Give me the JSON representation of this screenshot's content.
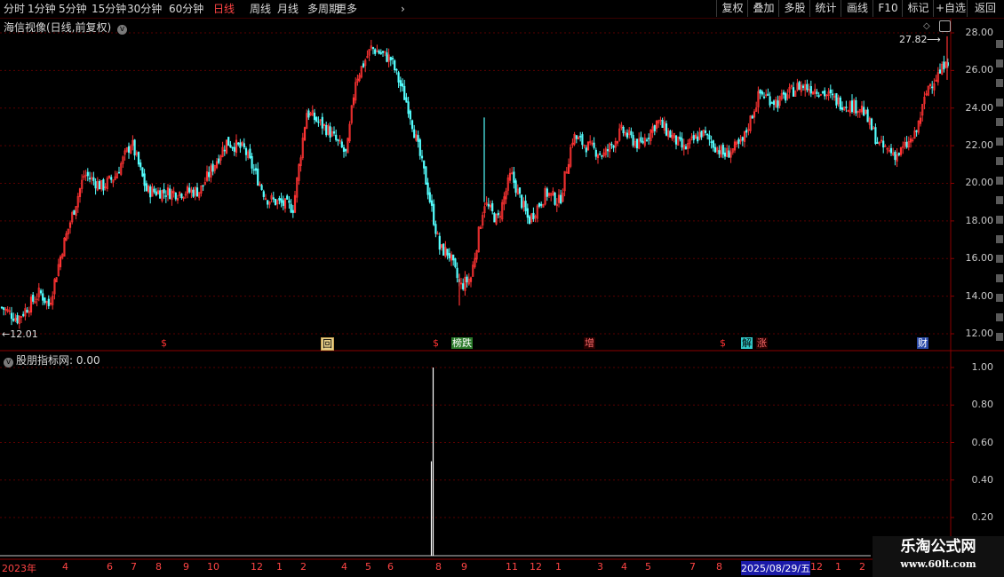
{
  "toolbar": {
    "periods": [
      "分时",
      "1分钟",
      "5分钟",
      "15分钟",
      "30分钟",
      "60分钟",
      "日线",
      "周线",
      "月线",
      "多周期",
      "更多"
    ],
    "active_period": "日线",
    "more_arrow": "›",
    "buttons": [
      "复权",
      "叠加",
      "多股",
      "统计",
      "画线",
      "F10",
      "标记",
      "+自选",
      "返回"
    ]
  },
  "main_panel": {
    "title": "海信视像(日线,前复权)",
    "title_dropdown_icon": "chevron-down-icon",
    "high_label": "27.82",
    "low_label": "12.01",
    "y_ticks": [
      "28.00",
      "26.00",
      "24.00",
      "22.00",
      "20.00",
      "18.00",
      "16.00",
      "14.00",
      "12.00"
    ],
    "markers": [
      {
        "text": "$",
        "kind": "dollar"
      },
      {
        "text": "回",
        "kind": "box"
      },
      {
        "text": "$",
        "kind": "dollar"
      },
      {
        "text": "榜跌",
        "kind": "green"
      },
      {
        "text": "增",
        "kind": "plain"
      },
      {
        "text": "$",
        "kind": "dollar"
      },
      {
        "text": "解",
        "kind": "cyan"
      },
      {
        "text": "涨",
        "kind": "plain"
      },
      {
        "text": "财",
        "kind": "blue"
      }
    ]
  },
  "indicator_panel": {
    "title": "股朋指标网",
    "value": ": 0.00",
    "y_ticks": [
      "1.00",
      "0.80",
      "0.60",
      "0.40",
      "0.20"
    ]
  },
  "x_axis": {
    "labels": [
      "2023年",
      "4",
      "6",
      "7",
      "8",
      "9",
      "10",
      "12",
      "1",
      "2",
      "4",
      "5",
      "6",
      "8",
      "9",
      "11",
      "12",
      "1",
      "3",
      "4",
      "5",
      "7",
      "8",
      "2025/08/29/五",
      "12",
      "1",
      "2"
    ]
  },
  "watermark": {
    "line1": "乐淘公式网",
    "line2": "www.60lt.com"
  },
  "colors": {
    "up": "#ff3333",
    "down": "#54ffff",
    "grid": "#5a0000",
    "axis": "#8b0000",
    "marker_red": "#ff3333"
  },
  "chart_data": {
    "type": "candlestick",
    "title": "海信视像(日线,前复权)",
    "ylim": [
      11.5,
      28.4
    ],
    "high": 27.82,
    "low": 12.01,
    "last_close_approx": 25.0,
    "indicator": {
      "name": "股朋指标网",
      "current": 0.0,
      "ylim": [
        0,
        1.05
      ],
      "spikes": [
        {
          "x_label": "8",
          "value": 1.0
        },
        {
          "x_label": "8",
          "value": 0.5
        }
      ]
    }
  }
}
